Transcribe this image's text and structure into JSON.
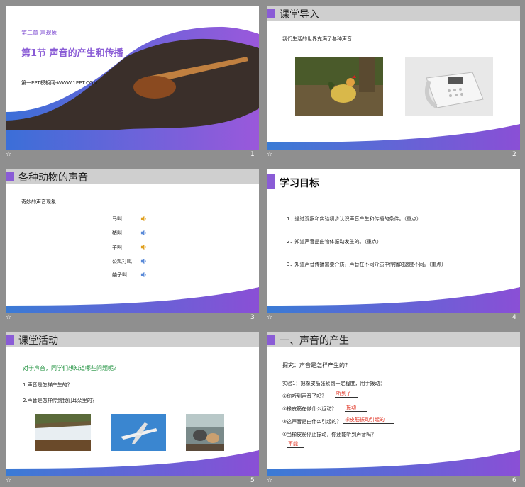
{
  "slides": [
    {
      "number": "1",
      "chapter": "第二章 声现象",
      "title": "第1节  声音的产生和传播",
      "site": "第一PPT模板网-WWW.1PPT.COM"
    },
    {
      "number": "2",
      "title": "课堂导入",
      "subtitle": "我们生活的世界充满了各种声音"
    },
    {
      "number": "3",
      "title": "各种动物的声音",
      "subtitle": "奇妙的声音现象",
      "items": [
        "马叫",
        "猪叫",
        "羊叫",
        "公鸡打鸣",
        "蛐子叫"
      ]
    },
    {
      "number": "4",
      "title": "学习目标",
      "goals": [
        "1．通过观察和实验初步认识声音产生和传播的条件。（重点）",
        "2．知道声音是由物体振动发生的。（重点）",
        "3．知道声音传播需要介质，声音在不同介质中传播的速度不同。（重点）"
      ]
    },
    {
      "number": "5",
      "title": "课堂活动",
      "question": "对于声音，同学们想知道哪些问题呢？",
      "items": [
        "1.声音是怎样产生的？",
        "2.声音是怎样传到我们耳朵里的？"
      ]
    },
    {
      "number": "6",
      "title": "一、声音的产生",
      "explore": "探究：声音是怎样产生的？",
      "experiment": "实验1：把橡皮筋张紧到一定程度，用手拨动：",
      "qa": [
        {
          "q": "①你听到声音了吗？",
          "a": "听到了"
        },
        {
          "q": "②橡皮筋在做什么运动？",
          "a": "振动"
        },
        {
          "q": "③这声音是由什么引起的？",
          "a": "橡皮筋振动引起的"
        },
        {
          "q": "④当橡皮筋停止振动，你还能听到声音吗？",
          "a": "不能"
        }
      ]
    }
  ],
  "footer_icon": "☆",
  "colors": {
    "accent": "#8a5cd6",
    "wave_blue": "#3a7bd5",
    "wave_purple": "#7a4fd0",
    "answer_red": "#e03020",
    "question_green": "#1a8f3a"
  }
}
